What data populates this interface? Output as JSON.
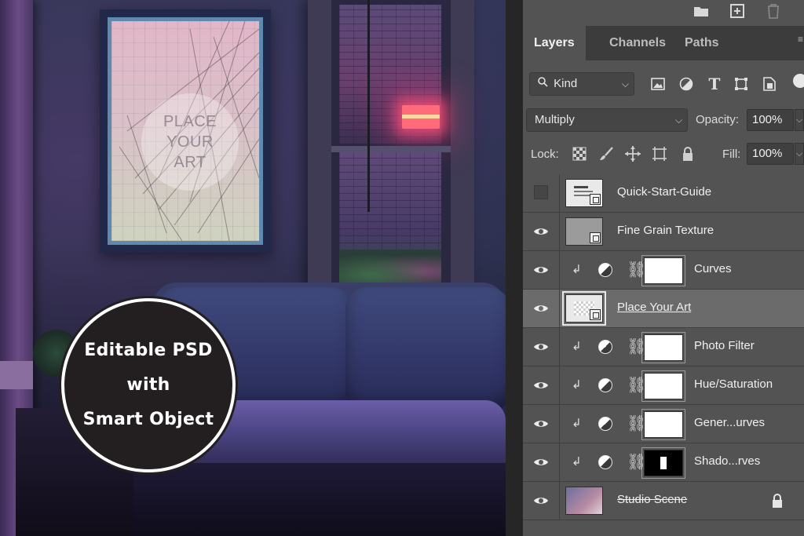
{
  "scene": {
    "frame_text": [
      "PLACE",
      "YOUR",
      "ART"
    ],
    "badge_lines": [
      "Editable PSD",
      "with",
      "Smart Object"
    ]
  },
  "panel": {
    "tabs": [
      {
        "label": "Layers",
        "active": true
      },
      {
        "label": "Channels",
        "active": false
      },
      {
        "label": "Paths",
        "active": false
      }
    ],
    "top_icons": [
      "folder-icon",
      "new-layer-icon",
      "trash-icon"
    ],
    "filter": {
      "kind_label": "Kind",
      "icons": [
        "image-filter-icon",
        "adjustment-filter-icon",
        "type-filter-icon",
        "shape-filter-icon",
        "smart-object-filter-icon"
      ]
    },
    "blend": {
      "mode": "Multiply",
      "opacity_label": "Opacity:",
      "opacity_value": "100%"
    },
    "lock": {
      "label": "Lock:",
      "fill_label": "Fill:",
      "fill_value": "100%",
      "icons": [
        "lock-transparent-icon",
        "lock-paint-icon",
        "lock-move-icon",
        "lock-artboard-icon",
        "lock-all-icon"
      ]
    },
    "layers": [
      {
        "name": "Quick-Start-Guide",
        "visible": false,
        "kind": "smart",
        "thumb": "light"
      },
      {
        "name": "Fine Grain Texture",
        "visible": true,
        "kind": "smart",
        "thumb": "grey"
      },
      {
        "name": "Curves",
        "visible": true,
        "kind": "adjustment",
        "mask": "white"
      },
      {
        "name": "Place Your Art",
        "visible": true,
        "kind": "smart",
        "thumb": "light",
        "selected": true,
        "style": "underlined"
      },
      {
        "name": "Photo Filter",
        "visible": true,
        "kind": "adjustment",
        "mask": "white"
      },
      {
        "name": "Hue/Saturation",
        "visible": true,
        "kind": "adjustment",
        "mask": "white"
      },
      {
        "name": "Gener...urves",
        "visible": true,
        "kind": "adjustment",
        "mask": "white"
      },
      {
        "name": "Shado...rves",
        "visible": true,
        "kind": "adjustment",
        "mask": "dark"
      },
      {
        "name": "Studio Scene",
        "visible": true,
        "kind": "background",
        "thumb": "photo",
        "style": "struck",
        "locked": true
      }
    ]
  }
}
